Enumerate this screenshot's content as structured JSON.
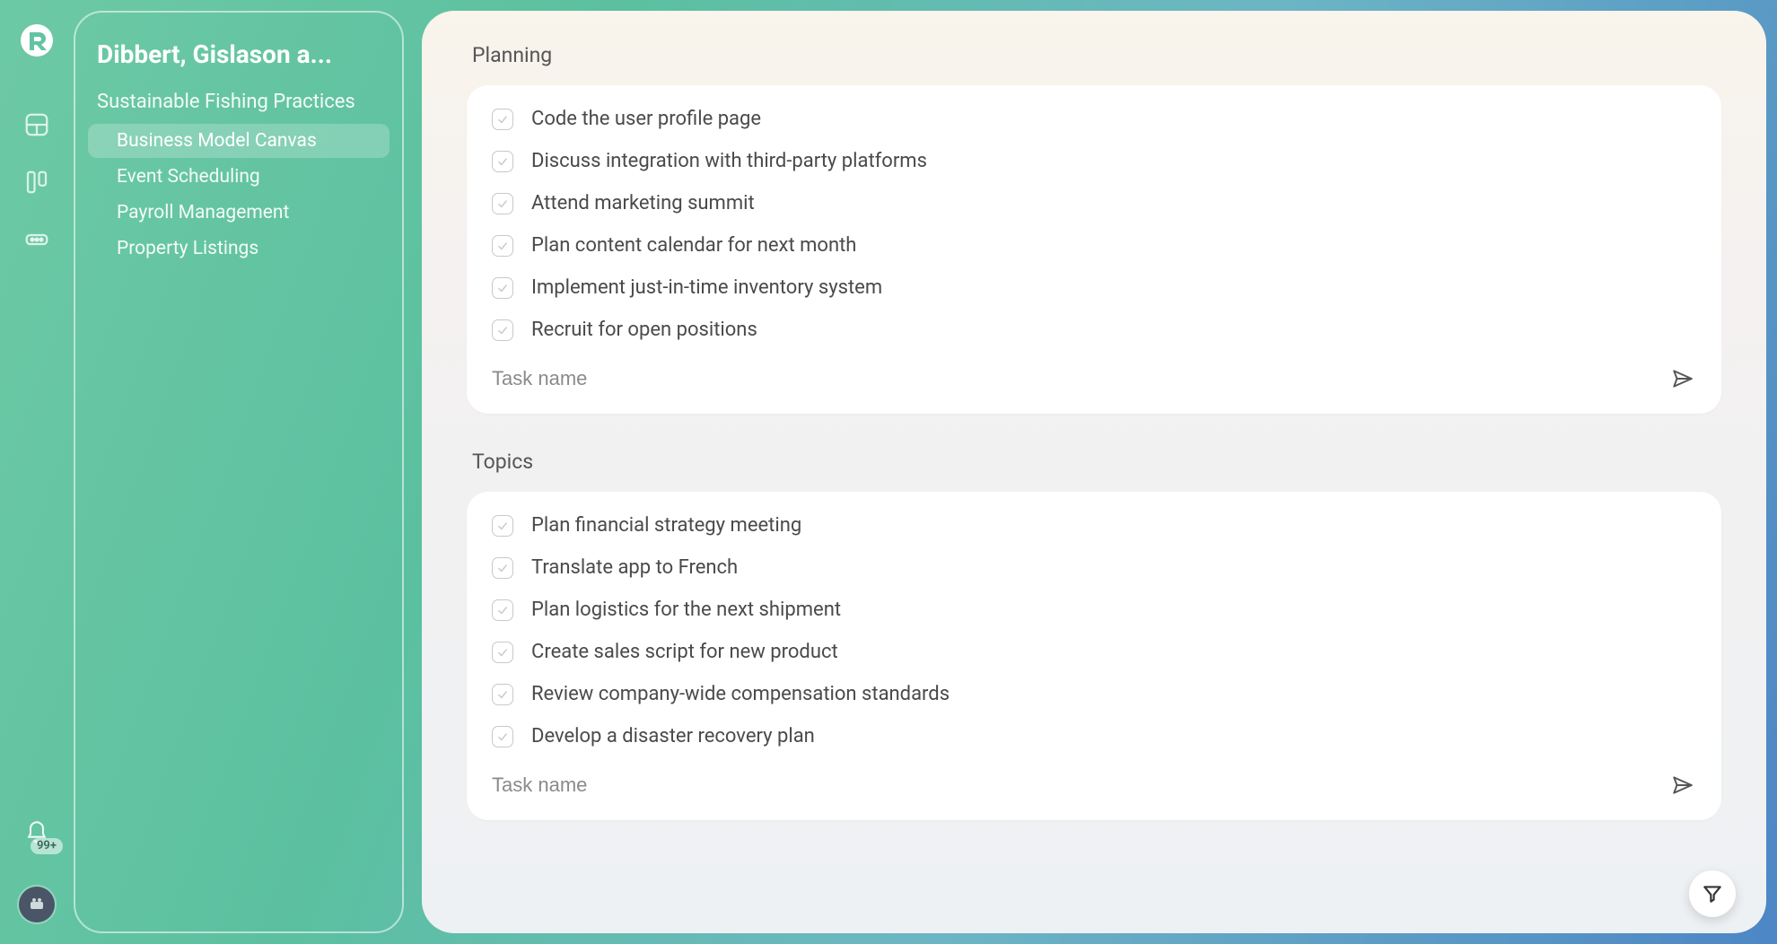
{
  "rail": {
    "badge_count": "99+"
  },
  "sidebar": {
    "workspace_title": "Dibbert, Gislason a...",
    "project_group": "Sustainable Fishing Practices",
    "items": [
      {
        "label": "Business Model Canvas",
        "active": true
      },
      {
        "label": "Event Scheduling",
        "active": false
      },
      {
        "label": "Payroll Management",
        "active": false
      },
      {
        "label": "Property Listings",
        "active": false
      }
    ]
  },
  "sections": [
    {
      "title": "Planning",
      "tasks": [
        "Code the user profile page",
        "Discuss integration with third-party platforms",
        "Attend marketing summit",
        "Plan content calendar for next month",
        "Implement just-in-time inventory system",
        "Recruit for open positions"
      ],
      "input_placeholder": "Task name"
    },
    {
      "title": "Topics",
      "tasks": [
        "Plan financial strategy meeting",
        "Translate app to French",
        "Plan logistics for the next shipment",
        "Create sales script for new product",
        "Review company-wide compensation standards",
        "Develop a disaster recovery plan"
      ],
      "input_placeholder": "Task name"
    }
  ]
}
